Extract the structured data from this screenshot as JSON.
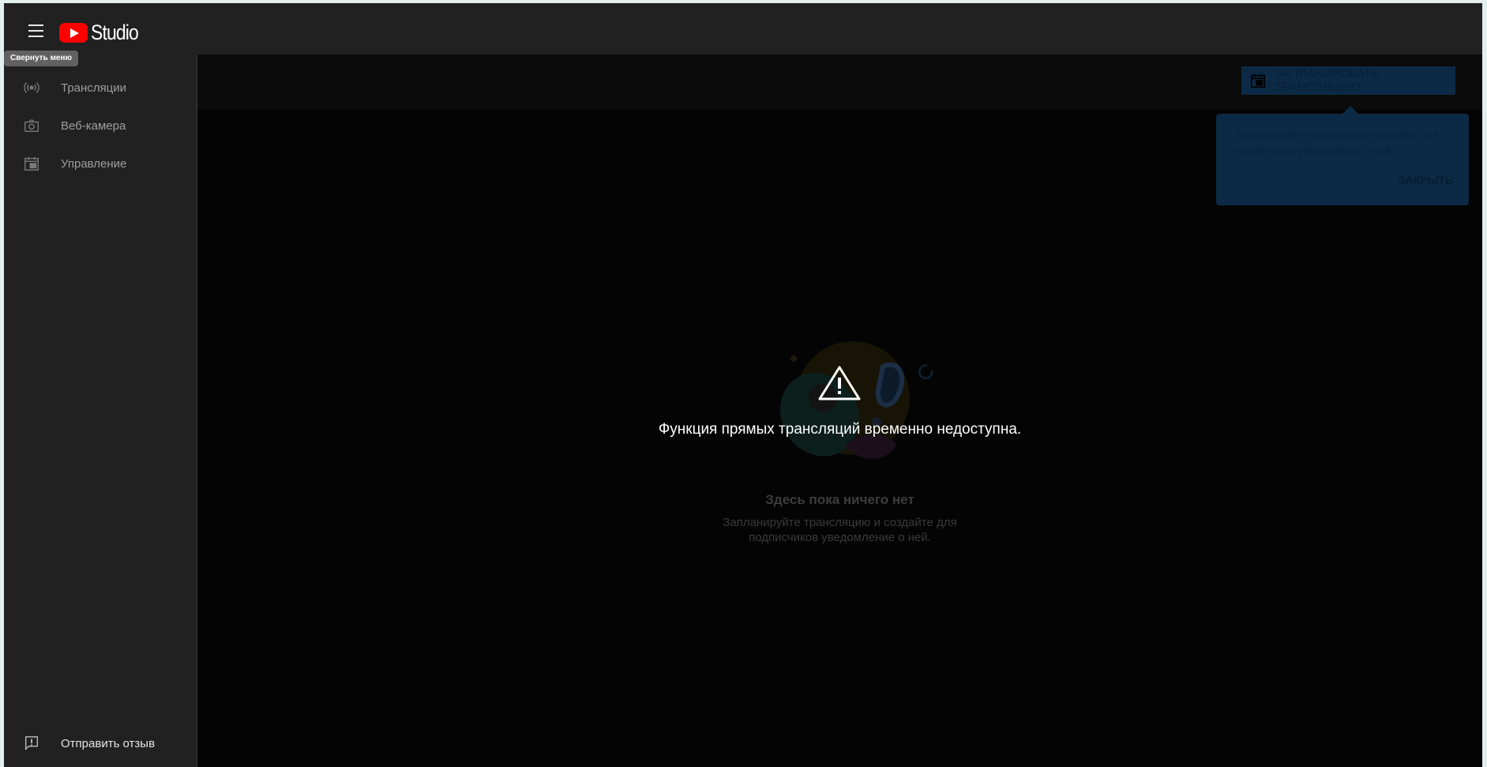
{
  "header": {
    "logo_text": "Studio",
    "menu_tooltip": "Свернуть меню"
  },
  "sidebar": {
    "items": [
      {
        "label": "Трансляции",
        "icon": "live-broadcast-icon"
      },
      {
        "label": "Веб-камера",
        "icon": "camera-icon"
      },
      {
        "label": "Управление",
        "icon": "calendar-icon"
      }
    ],
    "feedback": {
      "label": "Отправить отзыв",
      "icon": "feedback-icon"
    }
  },
  "main": {
    "schedule_button": "ЗАПЛАНИРОВАТЬ ТРАНСЛЯЦИЮ",
    "popup": {
      "text": "Запланируйте трансляцию и создайте для подписчиков уведомление о ней.",
      "close": "ЗАКРЫТЬ"
    },
    "warning": "Функция прямых трансляций временно недоступна.",
    "empty_title": "Здесь пока ничего нет",
    "empty_subtitle": "Запланируйте трансляцию и создайте для подписчиков уведомление о ней."
  },
  "colors": {
    "brand_red": "#ff0000",
    "popup_bg": "#0c2a45",
    "sidebar_bg": "#212121"
  }
}
